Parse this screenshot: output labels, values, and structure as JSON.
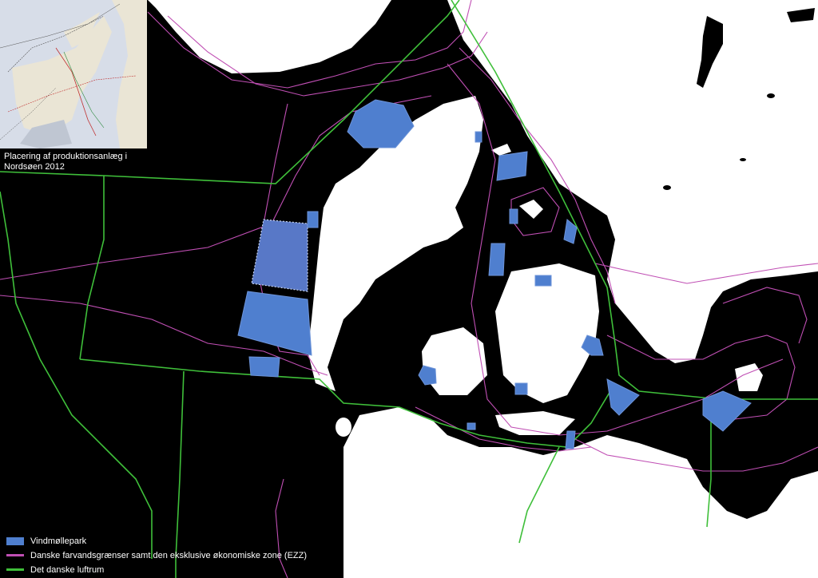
{
  "inset": {
    "caption": "Placering af produktionsanlæg i Nordsøen 2012"
  },
  "legend": {
    "items": [
      {
        "label": "Vindmøllepark",
        "color": "#4f7fcf",
        "kind": "area"
      },
      {
        "label": "Danske farvandsgrænser samt den eksklusive økonomiske zone (EZZ)",
        "color": "#c04fb4",
        "kind": "line"
      },
      {
        "label": "Det danske luftrum",
        "color": "#3fbf3a",
        "kind": "line"
      }
    ]
  },
  "colors": {
    "sea": "#000000",
    "land": "#ffffff",
    "windpark": "#4f7fcf",
    "ezz": "#c04fb4",
    "airspace": "#3fbf3a"
  }
}
